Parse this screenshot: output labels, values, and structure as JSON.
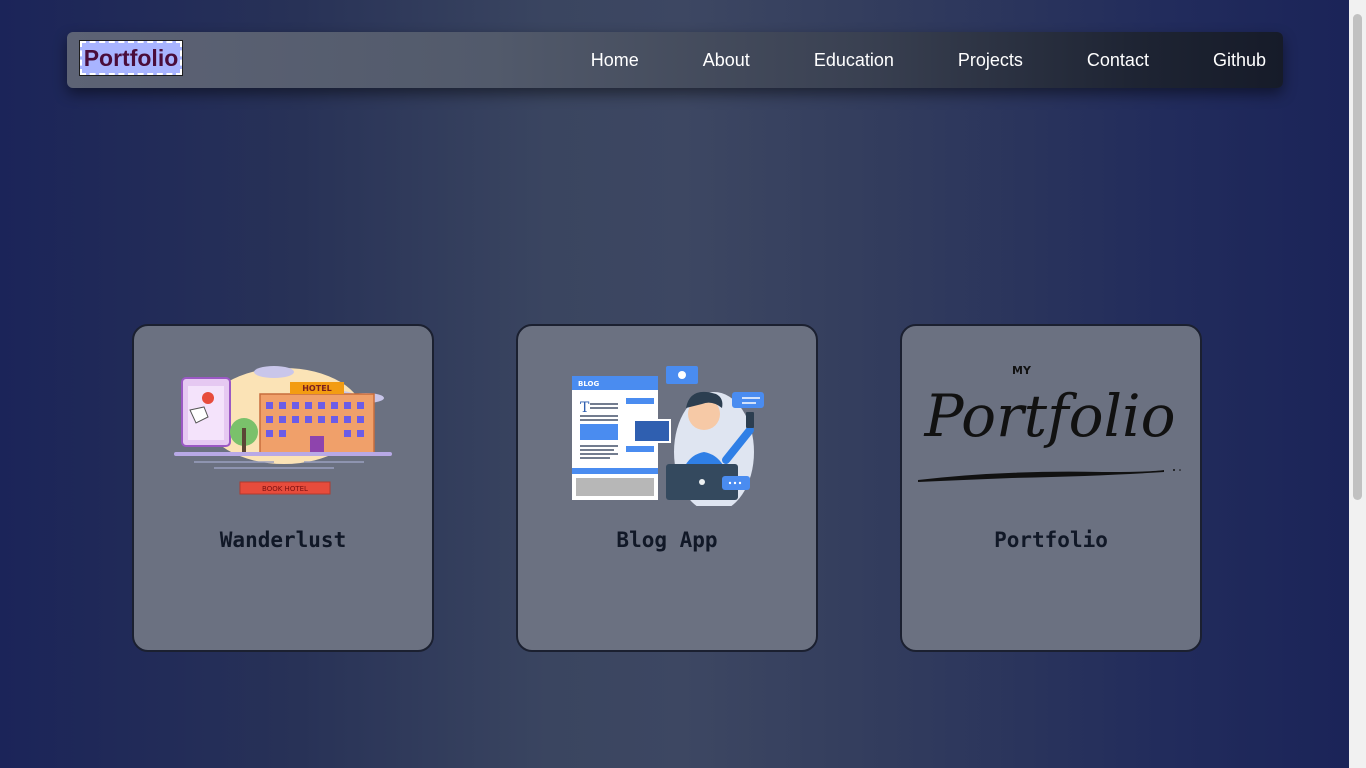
{
  "navbar": {
    "brand": "Portfolio",
    "links": [
      "Home",
      "About",
      "Education",
      "Projects",
      "Contact",
      "Github"
    ]
  },
  "projects": [
    {
      "title": "Wanderlust",
      "image": "hotel-booking-illustration",
      "image_text": {
        "hotel_sign": "HOTEL",
        "banner": "BOOK HOTEL"
      }
    },
    {
      "title": "Blog App",
      "image": "blog-writer-illustration",
      "image_text": {
        "page_header": "BLOG"
      }
    },
    {
      "title": "Portfolio",
      "image": "my-portfolio-logo",
      "image_text": {
        "small": "MY",
        "script": "Portfolio"
      }
    }
  ],
  "colors": {
    "brand_bg": "#a8b4ff",
    "brand_text": "#4a0d3a",
    "card_bg": "#6b7181",
    "page_bg": "#1b2459"
  }
}
